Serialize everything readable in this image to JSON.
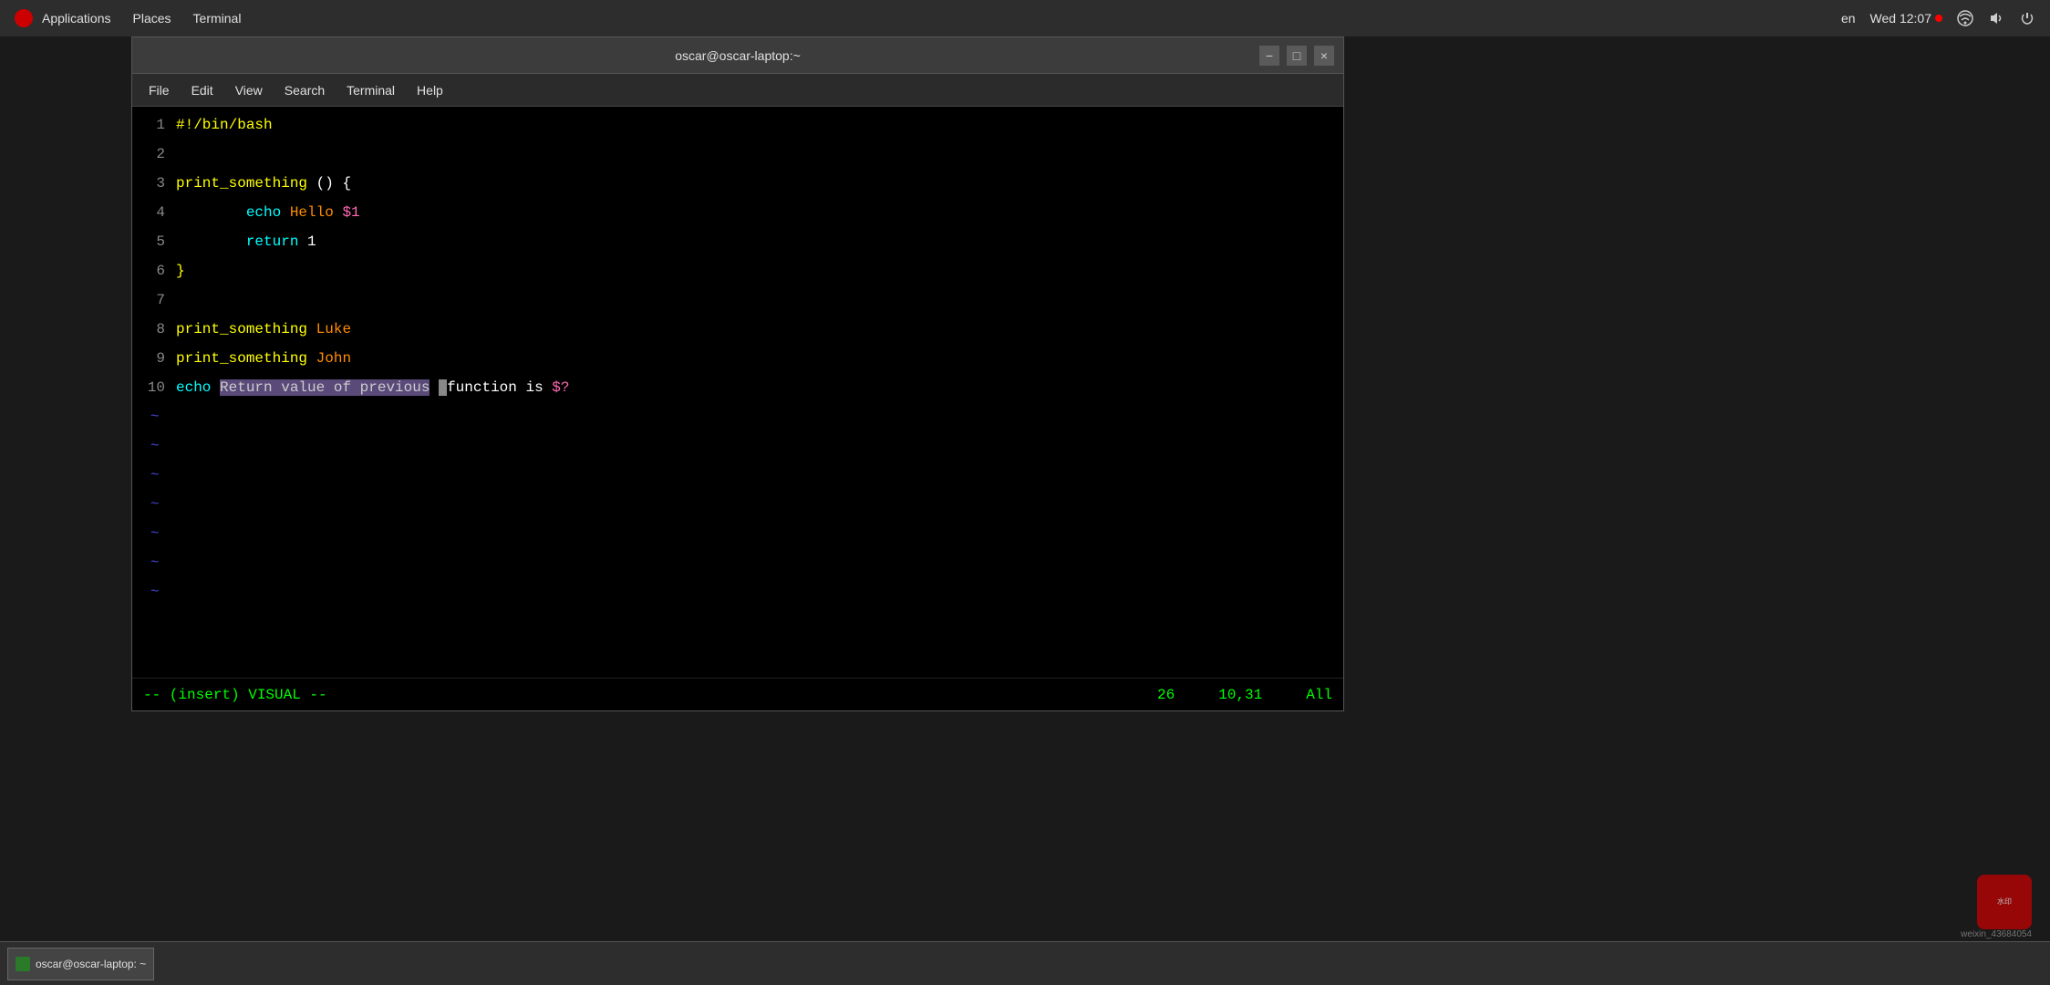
{
  "systembar": {
    "apps_label": "Applications",
    "places_label": "Places",
    "terminal_label": "Terminal",
    "lang": "en",
    "datetime": "Wed 12:07",
    "logo_alt": "distro-logo"
  },
  "window": {
    "title": "oscar@oscar-laptop:~",
    "minimize_label": "−",
    "maximize_label": "□",
    "close_label": "×"
  },
  "menu": {
    "file": "File",
    "edit": "Edit",
    "view": "View",
    "search": "Search",
    "terminal": "Terminal",
    "help": "Help"
  },
  "code": {
    "lines": [
      {
        "num": "1",
        "content": "#!/bin/bash"
      },
      {
        "num": "2",
        "content": ""
      },
      {
        "num": "3",
        "content": "print_something () {"
      },
      {
        "num": "4",
        "content": "        echo Hello $1"
      },
      {
        "num": "5",
        "content": "        return 1"
      },
      {
        "num": "6",
        "content": "}"
      },
      {
        "num": "7",
        "content": ""
      },
      {
        "num": "8",
        "content": "print_something Luke"
      },
      {
        "num": "9",
        "content": "print_something John"
      },
      {
        "num": "10",
        "content": "echo Return value of previous function is $?"
      }
    ],
    "tildes": 7
  },
  "statusbar": {
    "mode": "-- (insert) VISUAL --",
    "col26": "26",
    "pos": "10,31",
    "all": "All"
  },
  "taskbar": {
    "item_label": "oscar@oscar-laptop: ~"
  }
}
